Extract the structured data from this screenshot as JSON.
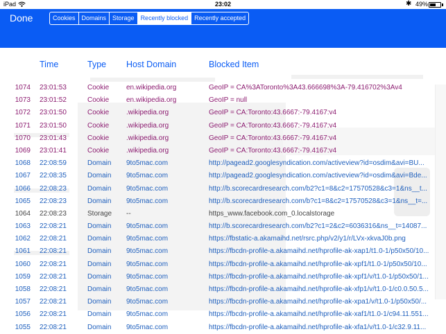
{
  "status_bar": {
    "carrier": "iPad",
    "time": "23:02",
    "battery_percent": "49%",
    "battery_level": 0.49,
    "wifi_icon": "wifi-icon",
    "bluetooth_icon": "bluetooth-icon"
  },
  "header": {
    "done_label": "Done",
    "segments": [
      "Cookies",
      "Domains",
      "Storage",
      "Recently blocked",
      "Recently accepted"
    ],
    "selected_segment": "Recently blocked",
    "background_color": "#0a5cf4"
  },
  "table": {
    "columns": [
      "Time",
      "Type",
      "Host Domain",
      "Blocked Item"
    ],
    "type_colors": {
      "Cookie": "#8b1a6f",
      "Domain": "#1e5fbd",
      "Storage": "#444444"
    },
    "rows": [
      {
        "id": "1074",
        "time": "23:01:53",
        "type": "Cookie",
        "host": "en.wikipedia.org",
        "item": "GeoIP = CA%3AToronto%3A43.666698%3A-79.416702%3Av4"
      },
      {
        "id": "1073",
        "time": "23:01:52",
        "type": "Cookie",
        "host": "en.wikipedia.org",
        "item": "GeoIP = null"
      },
      {
        "id": "1072",
        "time": "23:01:50",
        "type": "Cookie",
        "host": ".wikipedia.org",
        "item": "GeoIP = CA:Toronto:43.6667:-79.4167:v4"
      },
      {
        "id": "1071",
        "time": "23:01:50",
        "type": "Cookie",
        "host": ".wikipedia.org",
        "item": "GeoIP = CA:Toronto:43.6667:-79.4167:v4"
      },
      {
        "id": "1070",
        "time": "23:01:43",
        "type": "Cookie",
        "host": ".wikipedia.org",
        "item": "GeoIP = CA:Toronto:43.6667:-79.4167:v4"
      },
      {
        "id": "1069",
        "time": "23:01:41",
        "type": "Cookie",
        "host": ".wikipedia.org",
        "item": "GeoIP = CA:Toronto:43.6667:-79.4167:v4"
      },
      {
        "id": "1068",
        "time": "22:08:59",
        "type": "Domain",
        "host": "9to5mac.com",
        "item": "http://pagead2.googlesyndication.com/activeview?id=osdim&avi=BU..."
      },
      {
        "id": "1067",
        "time": "22:08:35",
        "type": "Domain",
        "host": "9to5mac.com",
        "item": "http://pagead2.googlesyndication.com/activeview?id=osdim&avi=Bde..."
      },
      {
        "id": "1066",
        "time": "22:08:23",
        "type": "Domain",
        "host": "9to5mac.com",
        "item": "http://b.scorecardresearch.com/b2?c1=8&c2=17570528&c3=1&ns__t..."
      },
      {
        "id": "1065",
        "time": "22:08:23",
        "type": "Domain",
        "host": "9to5mac.com",
        "item": "http://b.scorecardresearch.com/b?c1=8&c2=17570528&c3=1&ns__t=..."
      },
      {
        "id": "1064",
        "time": "22:08:23",
        "type": "Storage",
        "host": "--",
        "item": "https_www.facebook.com_0.localstorage"
      },
      {
        "id": "1063",
        "time": "22:08:21",
        "type": "Domain",
        "host": "9to5mac.com",
        "item": "http://b.scorecardresearch.com/b2?c1=2&c2=6036316&ns__t=14087..."
      },
      {
        "id": "1062",
        "time": "22:08:21",
        "type": "Domain",
        "host": "9to5mac.com",
        "item": "https://fbstatic-a.akamaihd.net/rsrc.php/v2/y1/r/LVx-xkvaJ0b.png"
      },
      {
        "id": "1061",
        "time": "22:08:21",
        "type": "Domain",
        "host": "9to5mac.com",
        "item": "https://fbcdn-profile-a.akamaihd.net/hprofile-ak-xap1/t1.0-1/p50x50/10..."
      },
      {
        "id": "1060",
        "time": "22:08:21",
        "type": "Domain",
        "host": "9to5mac.com",
        "item": "https://fbcdn-profile-a.akamaihd.net/hprofile-ak-xpf1/t1.0-1/p50x50/10..."
      },
      {
        "id": "1059",
        "time": "22:08:21",
        "type": "Domain",
        "host": "9to5mac.com",
        "item": "https://fbcdn-profile-a.akamaihd.net/hprofile-ak-xpf1/v/t1.0-1/p50x50/1..."
      },
      {
        "id": "1058",
        "time": "22:08:21",
        "type": "Domain",
        "host": "9to5mac.com",
        "item": "https://fbcdn-profile-a.akamaihd.net/hprofile-ak-xfp1/v/t1.0-1/c0.0.50.5..."
      },
      {
        "id": "1057",
        "time": "22:08:21",
        "type": "Domain",
        "host": "9to5mac.com",
        "item": "https://fbcdn-profile-a.akamaihd.net/hprofile-ak-xpa1/v/t1.0-1/p50x50/..."
      },
      {
        "id": "1056",
        "time": "22:08:21",
        "type": "Domain",
        "host": "9to5mac.com",
        "item": "https://fbcdn-profile-a.akamaihd.net/hprofile-ak-xaf1/t1.0-1/c94.11.551..."
      },
      {
        "id": "1055",
        "time": "22:08:21",
        "type": "Domain",
        "host": "9to5mac.com",
        "item": "https://fbcdn-profile-a.akamaihd.net/hprofile-ak-xfa1/v/t1.0-1/c32.9.11..."
      }
    ]
  }
}
